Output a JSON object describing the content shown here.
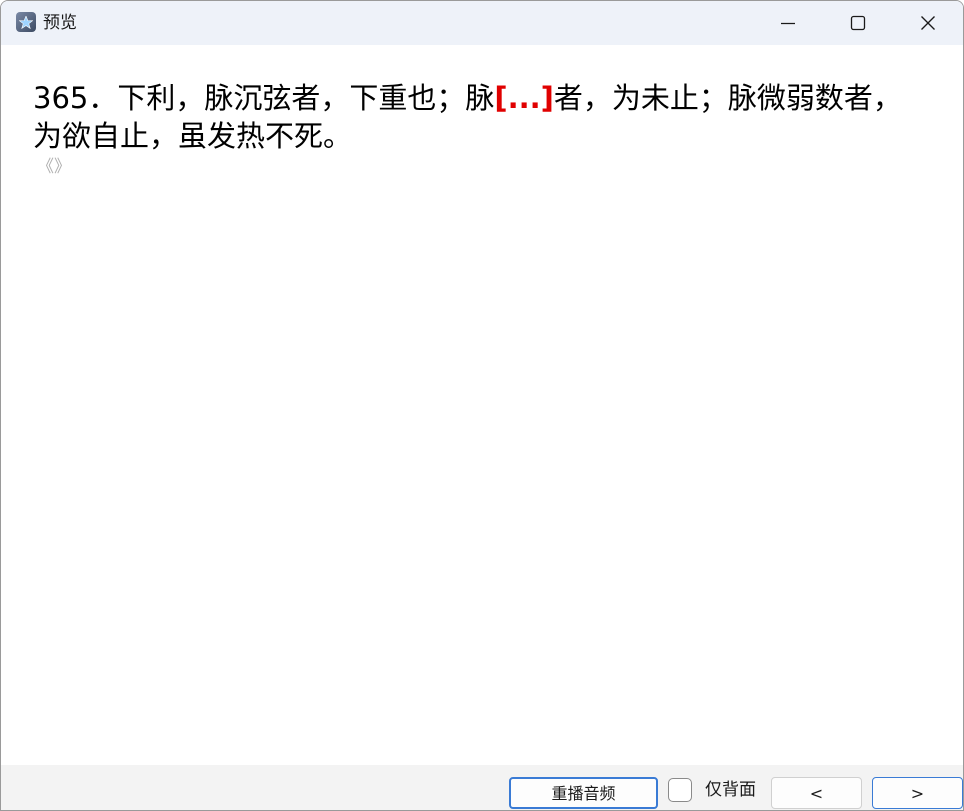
{
  "window": {
    "title": "预览",
    "app_icon": "star-note-icon",
    "controls": {
      "minimize_icon": "minimize-icon",
      "maximize_icon": "maximize-icon",
      "close_icon": "close-icon"
    }
  },
  "card": {
    "text_before": "365．下利，脉沉弦者，下重也；脉",
    "cloze": "[...]",
    "text_after": "者，为未止；脉微弱数者，为欲自止，虽发热不死。",
    "source": "《》",
    "cloze_color": "#e00000"
  },
  "footer": {
    "replay_label": "重播音频",
    "back_only_label": "仅背面",
    "back_only_checked": false,
    "prev_label": "<",
    "next_label": ">",
    "accent_color": "#3a7bd5"
  }
}
